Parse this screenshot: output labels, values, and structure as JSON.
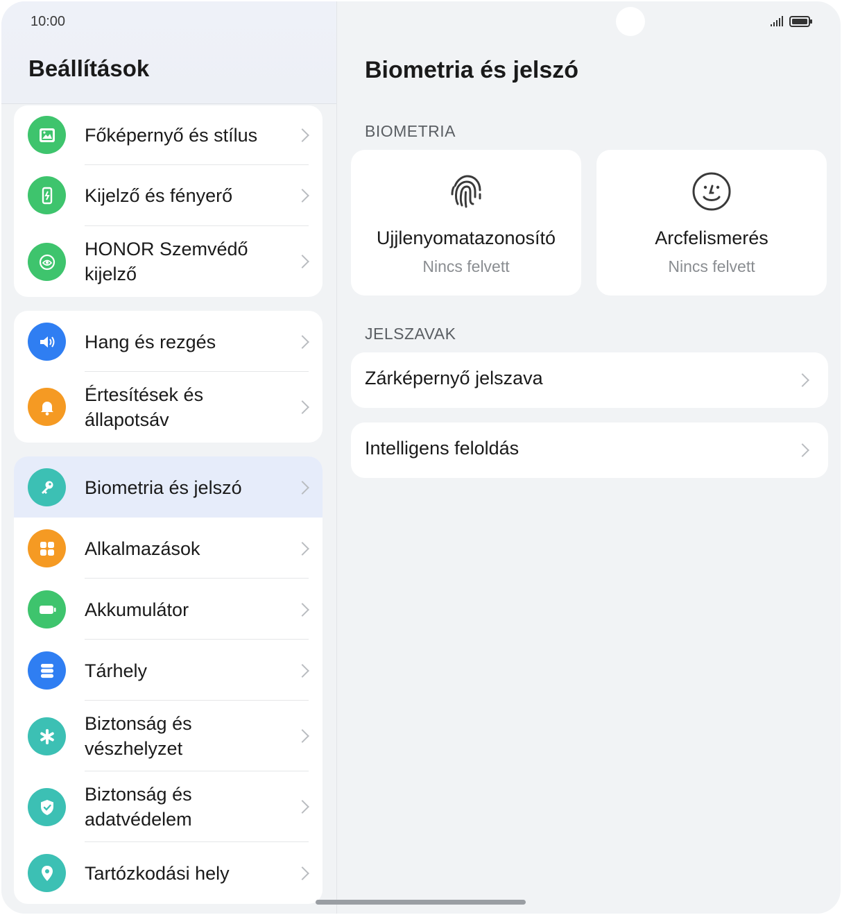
{
  "status": {
    "time": "10:00"
  },
  "left": {
    "title": "Beállítások",
    "groups": [
      {
        "items": [
          {
            "label": "Főképernyő és stílus",
            "icon": "image-icon",
            "color": "#3ec46d"
          },
          {
            "label": "Kijelző és fényerő",
            "icon": "display-icon",
            "color": "#3ec46d"
          },
          {
            "label": "HONOR Szemvédő kijelző",
            "icon": "eye-comfort-icon",
            "color": "#3ec46d"
          }
        ]
      },
      {
        "items": [
          {
            "label": "Hang és rezgés",
            "icon": "speaker-icon",
            "color": "#2f7ef2"
          },
          {
            "label": "Értesítések és állapotsáv",
            "icon": "bell-icon",
            "color": "#f59a23"
          }
        ]
      },
      {
        "items": [
          {
            "label": "Biometria és jelszó",
            "icon": "key-icon",
            "color": "#3cc0b4",
            "selected": true
          },
          {
            "label": "Alkalmazások",
            "icon": "apps-icon",
            "color": "#f59a23"
          },
          {
            "label": "Akkumulátor",
            "icon": "battery-icon",
            "color": "#3ec46d"
          },
          {
            "label": "Tárhely",
            "icon": "storage-icon",
            "color": "#2f7ef2"
          },
          {
            "label": "Biztonság és vészhelyzet",
            "icon": "emergency-icon",
            "color": "#3cc0b4"
          },
          {
            "label": "Biztonság és adatvédelem",
            "icon": "shield-icon",
            "color": "#3cc0b4"
          },
          {
            "label": "Tartózkodási hely",
            "icon": "location-icon",
            "color": "#3cc0b4"
          }
        ]
      }
    ]
  },
  "right": {
    "title": "Biometria és jelszó",
    "biometria_section": "BIOMETRIA",
    "fingerprint": {
      "title": "Ujjlenyomatazonosító",
      "subtitle": "Nincs felvett"
    },
    "face": {
      "title": "Arcfelismerés",
      "subtitle": "Nincs felvett"
    },
    "jelszavak_section": "JELSZAVAK",
    "rows": [
      {
        "label": "Zárképernyő jelszava"
      },
      {
        "label": "Intelligens feloldás"
      }
    ]
  }
}
